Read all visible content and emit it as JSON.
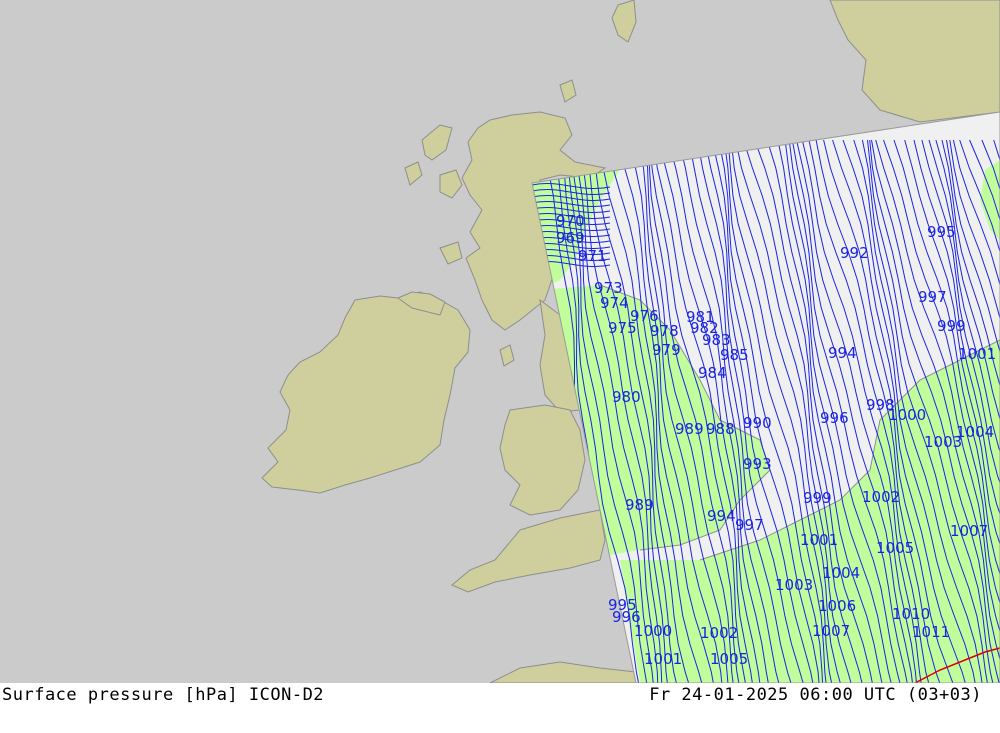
{
  "footer": {
    "left": "Surface pressure [hPa] ICON-D2",
    "right": "Fr 24-01-2025 06:00 UTC (03+03)"
  },
  "colors": {
    "sea": "#cbcbcb",
    "land": "#cfcf9e",
    "coast": "#8e8e8e",
    "domain_fill": "#f0f0f0",
    "land_in_domain": "#c2fd9c",
    "isobar": "#1a24e0",
    "isobar_label": "#1a24e0",
    "frontier": "#d80000"
  },
  "isobar_labels": [
    "970",
    "969",
    "971",
    "973",
    "974",
    "975",
    "976",
    "978",
    "979",
    "980",
    "981",
    "982",
    "983",
    "984",
    "985",
    "988",
    "989",
    "989",
    "990",
    "992",
    "993",
    "994",
    "994",
    "995",
    "995",
    "996",
    "996",
    "997",
    "997",
    "998",
    "999",
    "999",
    "1000",
    "1000",
    "1001",
    "1001",
    "1001",
    "1002",
    "1002",
    "1003",
    "1003",
    "1004",
    "1004",
    "1005",
    "1005",
    "1006",
    "1007",
    "1007",
    "1010",
    "1011"
  ]
}
